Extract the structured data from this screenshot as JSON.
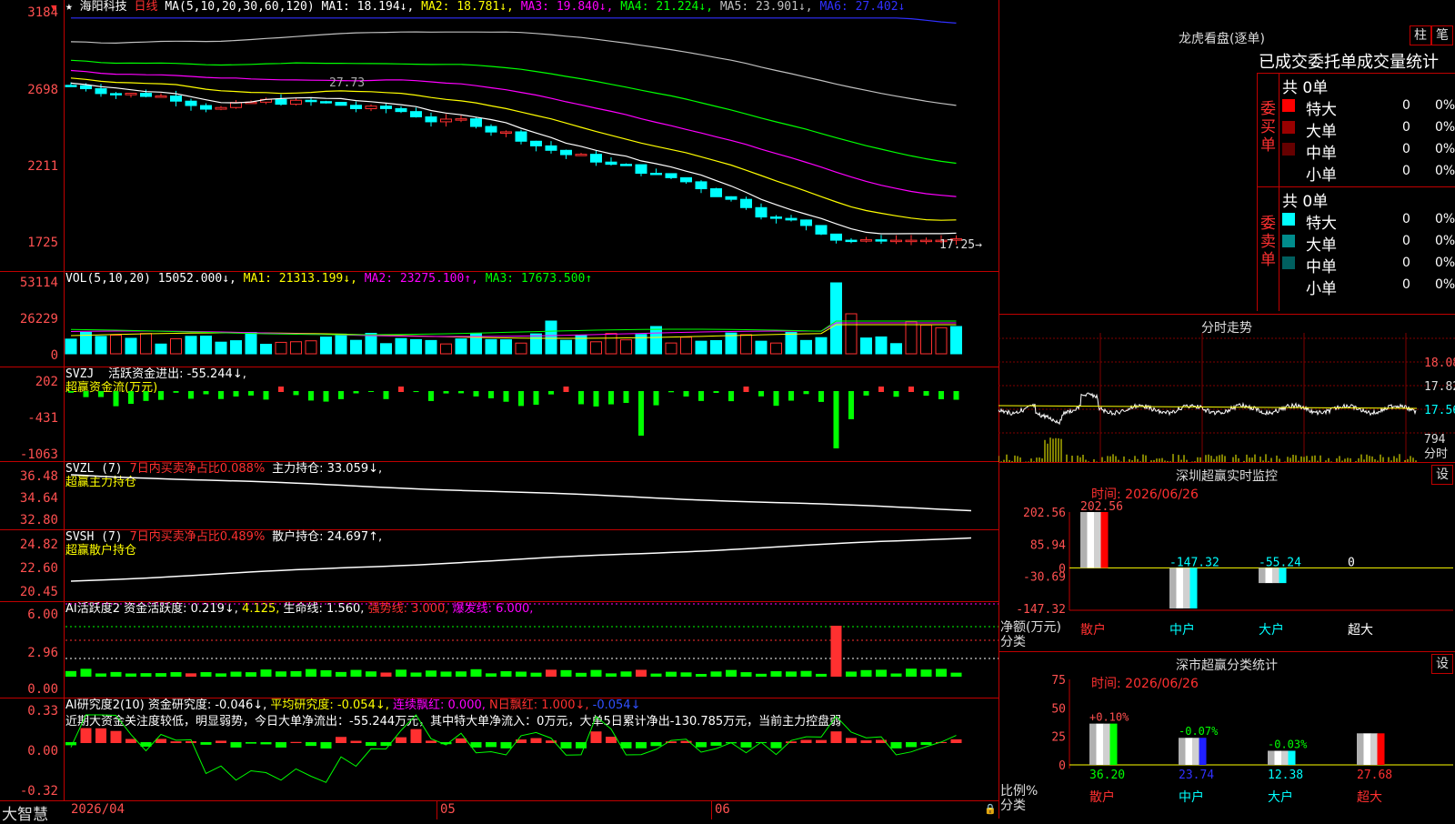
{
  "app": {
    "brand": "大智慧"
  },
  "main_chart": {
    "stock_name": "海阳科技",
    "period": "日线",
    "ma_label": "MA(5,10,20,30,60,120)",
    "ma1": "MA1: 18.194↓,",
    "ma2": "MA2: 18.781↓,",
    "ma3": "MA3: 19.840↓,",
    "ma4": "MA4: 21.224↓,",
    "ma5": "MA5: 23.901↓,",
    "ma6": "MA6: 27.402↓",
    "y_ticks": [
      "3184",
      "2698",
      "2211",
      "1725"
    ],
    "high_label": "27.73",
    "low_label": "17.25→",
    "colors": {
      "ma1": "#ffffff",
      "ma2": "#ffff00",
      "ma3": "#ff00ff",
      "ma4": "#00ff00",
      "ma5": "#c0c0c0",
      "ma6": "#3030ff"
    }
  },
  "vol_panel": {
    "label": "VOL(5,10,20)",
    "value": "15052.000↓,",
    "ma1": "MA1: 21313.199↓,",
    "ma2": "MA2: 23275.100↑,",
    "ma3": "MA3: 17673.500↑",
    "y_ticks": [
      "53114",
      "26229",
      "0"
    ]
  },
  "svzj_panel": {
    "label": "SVZJ",
    "title": "活跃资金进出: -55.244↓,",
    "subtitle": "超赢资金流(万元)",
    "y_ticks": [
      "202",
      "-431",
      "-1063"
    ]
  },
  "svzl_panel": {
    "label": "SVZL (7)",
    "ratio": "7日内买卖净占比0.088%",
    "hold": "主力持仓: 33.059↓,",
    "subtitle": "超赢主力持仓",
    "y_ticks": [
      "36.48",
      "34.64",
      "32.80"
    ]
  },
  "svsh_panel": {
    "label": "SVSH (7)",
    "ratio": "7日内买卖净占比0.489%",
    "hold": "散户持仓: 24.697↑,",
    "subtitle": "超赢散户持仓",
    "y_ticks": [
      "24.82",
      "22.60",
      "20.45"
    ]
  },
  "ai_activity": {
    "label": "AI活跃度2",
    "a": "资金活跃度: 0.219↓,",
    "b": "4.125,",
    "c": "生命线: 1.560,",
    "d": "强势线: 3.000,",
    "e": "爆发线: 6.000,",
    "y_ticks": [
      "6.00",
      "2.96",
      "0.00"
    ]
  },
  "ai_research": {
    "label": "AI研究度2(10)",
    "a": "资金研究度: -0.046↓,",
    "b": "平均研究度: -0.054↓,",
    "c": "连续飘红: 0.000,",
    "d": "N日飘红: 1.000↓,",
    "e": "-0.054↓",
    "comment": "近期大资金关注度较低，明显弱势，今日大单净流出：-55.244万元，其中特大单净流入：0万元，大单5日累计净出-130.785万元，当前主力控盘弱",
    "y_ticks": [
      "0.33",
      "0.00",
      "-0.32"
    ]
  },
  "x_axis": {
    "labels": [
      "2026/04",
      "05",
      "06"
    ]
  },
  "dragon": {
    "title": "龙虎看盘(逐单)",
    "btn_column": "柱",
    "btn_pen": "笔",
    "header": "已成交委托单成交量统计",
    "buy_label": "委买单",
    "sell_label": "委卖单",
    "buy_total": "共 0单",
    "sell_total": "共 0单",
    "buy_rows": [
      {
        "name": "特大",
        "count": "0",
        "pct": "0%",
        "color": "#ff0000"
      },
      {
        "name": "大单",
        "count": "0",
        "pct": "0%",
        "color": "#990000"
      },
      {
        "name": "中单",
        "count": "0",
        "pct": "0%",
        "color": "#660000"
      },
      {
        "name": "小单",
        "count": "0",
        "pct": "0%",
        "color": "#000000"
      }
    ],
    "sell_rows": [
      {
        "name": "特大",
        "count": "0",
        "pct": "0%",
        "color": "#00ffff"
      },
      {
        "name": "大单",
        "count": "0",
        "pct": "0%",
        "color": "#008c8c"
      },
      {
        "name": "中单",
        "count": "0",
        "pct": "0%",
        "color": "#005f5f"
      },
      {
        "name": "小单",
        "count": "0",
        "pct": "0%",
        "color": "#000000"
      }
    ]
  },
  "intraday": {
    "title": "分时走势",
    "y_ticks": [
      "18.08",
      "17.82",
      "17.56"
    ],
    "vol_tick": "794",
    "vol_label": "分时"
  },
  "sz_monitor": {
    "title": "深圳超赢实时监控",
    "btn": "设",
    "time": "时间: 2026/06/26",
    "y_ticks": [
      "202.56",
      "85.94",
      "0",
      "-30.69",
      "-147.32"
    ],
    "ylabel": "净额(万元)",
    "xlabel": "分类",
    "categories": [
      "散户",
      "中户",
      "大户",
      "超大"
    ],
    "values": [
      202.56,
      -147.32,
      -55.24,
      0
    ],
    "value_labels": [
      "202.56",
      "-147.32",
      "-55.24",
      "0"
    ]
  },
  "sz_stats": {
    "title": "深市超赢分类统计",
    "btn": "设",
    "time": "时间: 2026/06/26",
    "y_ticks": [
      "75",
      "50",
      "25",
      "0"
    ],
    "ylabel": "比例%",
    "xlabel": "分类",
    "categories": [
      "散户",
      "中户",
      "大户",
      "超大"
    ],
    "values": [
      36.2,
      23.74,
      12.38,
      27.68
    ],
    "changes": [
      "+0.10%",
      "-0.07%",
      "-0.03%",
      ""
    ]
  },
  "chart_data": [
    {
      "type": "bar",
      "title": "深圳超赢实时监控",
      "categories": [
        "散户",
        "中户",
        "大户",
        "超大"
      ],
      "values": [
        202.56,
        -147.32,
        -55.24,
        0
      ],
      "ylabel": "净额(万元)",
      "xlabel": "分类",
      "ylim": [
        -147.32,
        202.56
      ]
    },
    {
      "type": "bar",
      "title": "深市超赢分类统计",
      "categories": [
        "散户",
        "中户",
        "大户",
        "超大"
      ],
      "values": [
        36.2,
        23.74,
        12.38,
        27.68
      ],
      "ylabel": "比例%",
      "xlabel": "分类",
      "ylim": [
        0,
        75
      ]
    }
  ]
}
